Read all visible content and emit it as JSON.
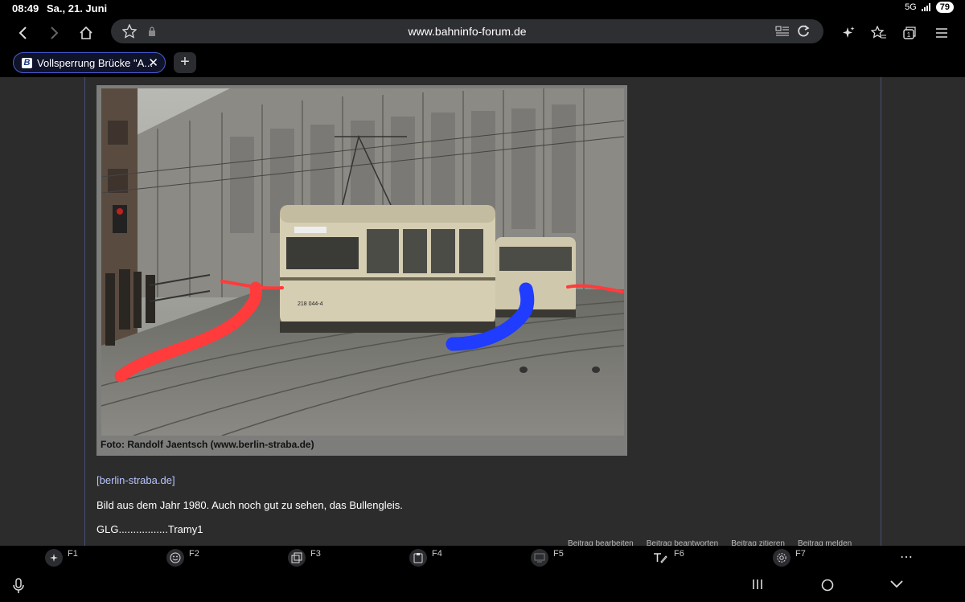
{
  "status": {
    "time": "08:49",
    "date": "Sa., 21. Juni",
    "network": "5G",
    "battery": "79"
  },
  "browser": {
    "url": "www.bahninfo-forum.de"
  },
  "tab": {
    "title": "Vollsperrung Brücke \"A...",
    "favicon_letter": "B"
  },
  "photo": {
    "caption": "Foto: Randolf Jaentsch (www.berlin-straba.de)",
    "tram_number": "218 044-4"
  },
  "post": {
    "link": "[berlin-straba.de]",
    "text1": "Bild aus dem Jahr 1980. Auch noch gut zu sehen, das Bullengleis.",
    "text2": "GLG.................Tramy1",
    "actions": [
      "Beitrag bearbeiten",
      "Beitrag beantworten",
      "Beitrag zitieren",
      "Beitrag melden"
    ]
  },
  "fkeys": [
    "F1",
    "F2",
    "F3",
    "F4",
    "F5",
    "F6",
    "F7"
  ],
  "colors": {
    "accent": "#4a5bd6",
    "link": "#b7c4ff",
    "red_mark": "#ff3b3b",
    "blue_mark": "#1f3cff"
  }
}
